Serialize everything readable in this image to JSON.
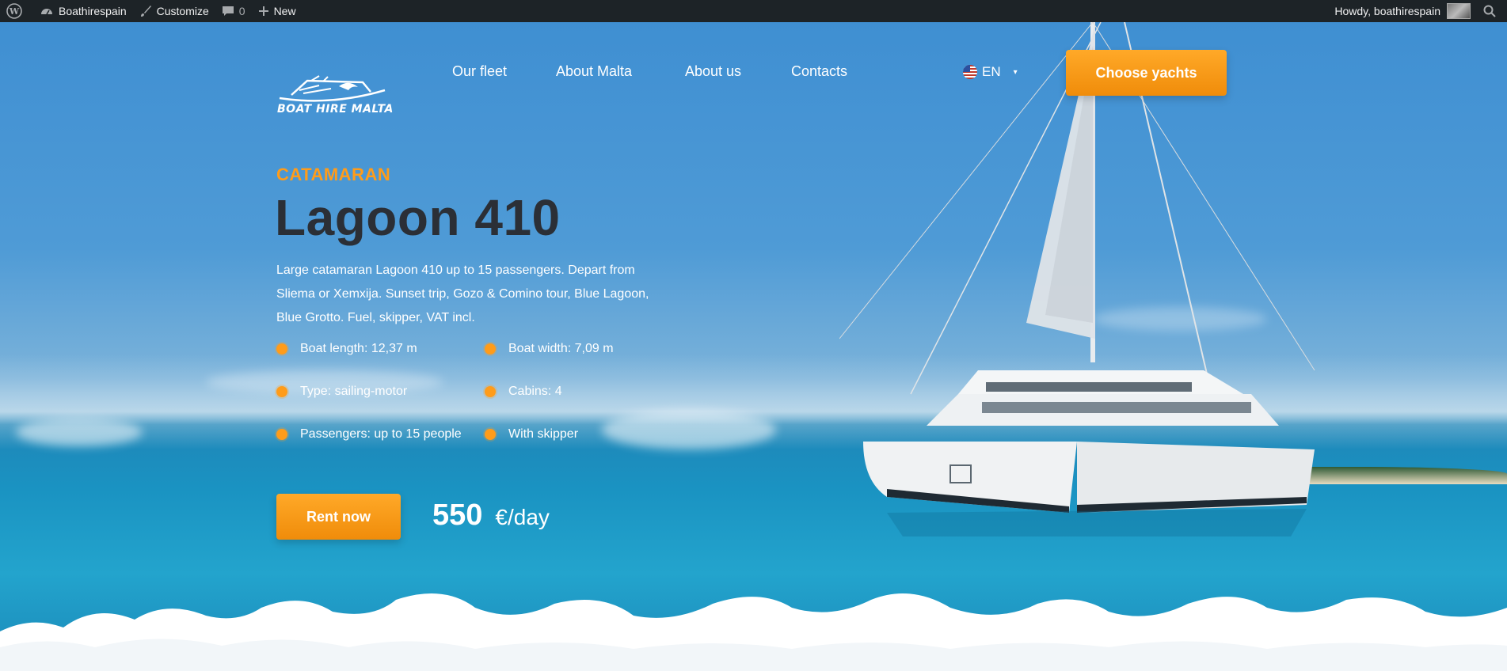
{
  "adminbar": {
    "site_name": "Boathirespain",
    "customize": "Customize",
    "comments_count": "0",
    "new": "New",
    "howdy": "Howdy, boathirespain"
  },
  "header": {
    "logo_text": "BOAT HIRE MALTA",
    "nav": [
      "Our fleet",
      "About Malta",
      "About us",
      "Contacts"
    ],
    "language": "EN",
    "cta": "Choose yachts"
  },
  "product": {
    "category": "CATAMARAN",
    "name": "Lagoon 410",
    "description": "Large catamaran Lagoon 410 up to 15 passengers. Depart from Sliema or Xemxija. Sunset trip, Gozo & Comino tour, Blue Lagoon, Blue Grotto. Fuel, skipper, VAT incl.",
    "specs": [
      "Boat length: 12,37 m",
      "Boat width: 7,09 m",
      "Type: sailing-motor",
      "Cabins: 4",
      "Passengers: up to 15 people",
      "With skipper"
    ],
    "rent_label": "Rent now",
    "price": "550",
    "price_unit": "€/day"
  },
  "colors": {
    "accent": "#ff9c1a",
    "admin_bar": "#1d2327",
    "title": "#2b2f36"
  }
}
